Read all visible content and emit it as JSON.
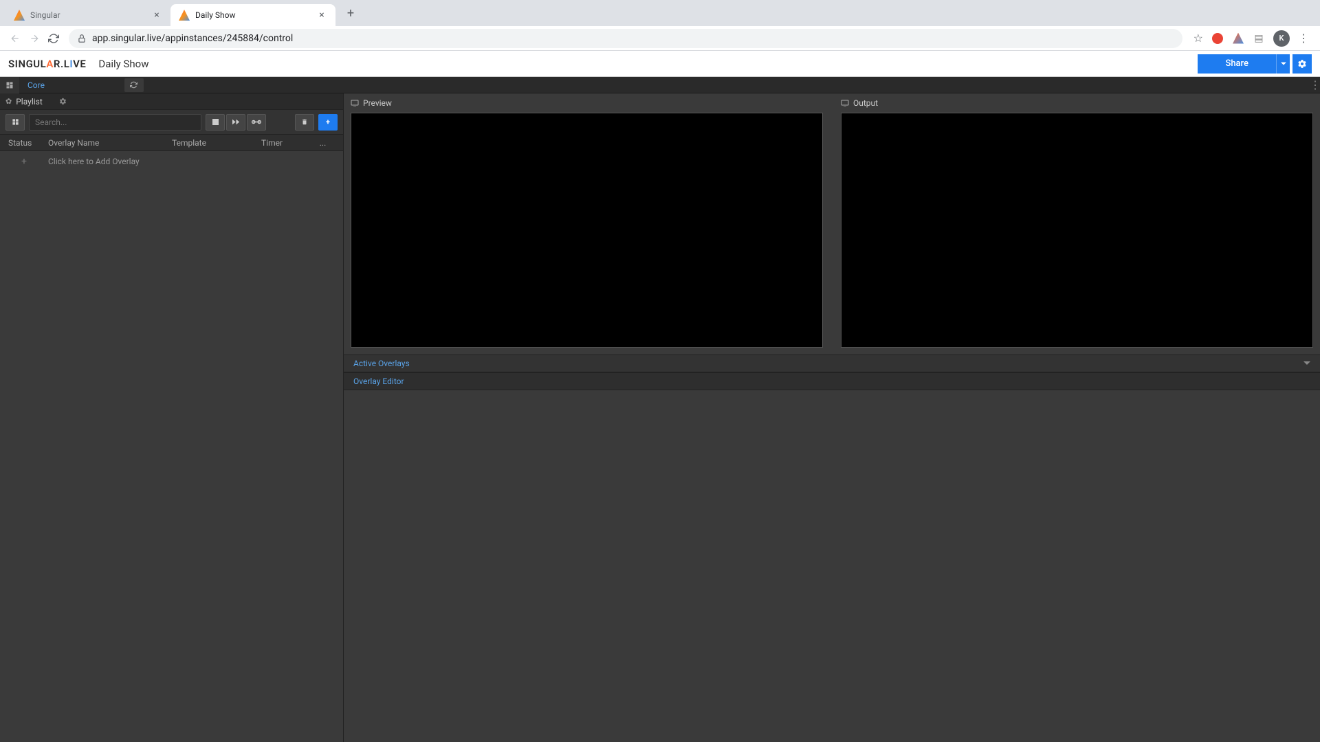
{
  "browser": {
    "tabs": [
      {
        "title": "Singular",
        "active": false
      },
      {
        "title": "Daily Show",
        "active": true
      }
    ],
    "url": "app.singular.live/appinstances/245884/control",
    "avatar_initial": "K"
  },
  "header": {
    "logo": "SINGULAR.LIVE",
    "show_name": "Daily Show",
    "share_label": "Share"
  },
  "subheader": {
    "core_label": "Core"
  },
  "playlist": {
    "label": "Playlist",
    "search_placeholder": "Search...",
    "columns": {
      "status": "Status",
      "name": "Overlay Name",
      "template": "Template",
      "timer": "Timer",
      "more": "..."
    },
    "add_overlay_label": "Click here to Add Overlay"
  },
  "viewers": {
    "preview_label": "Preview",
    "output_label": "Output"
  },
  "panels": {
    "active_overlays_label": "Active Overlays",
    "overlay_editor_label": "Overlay Editor"
  }
}
